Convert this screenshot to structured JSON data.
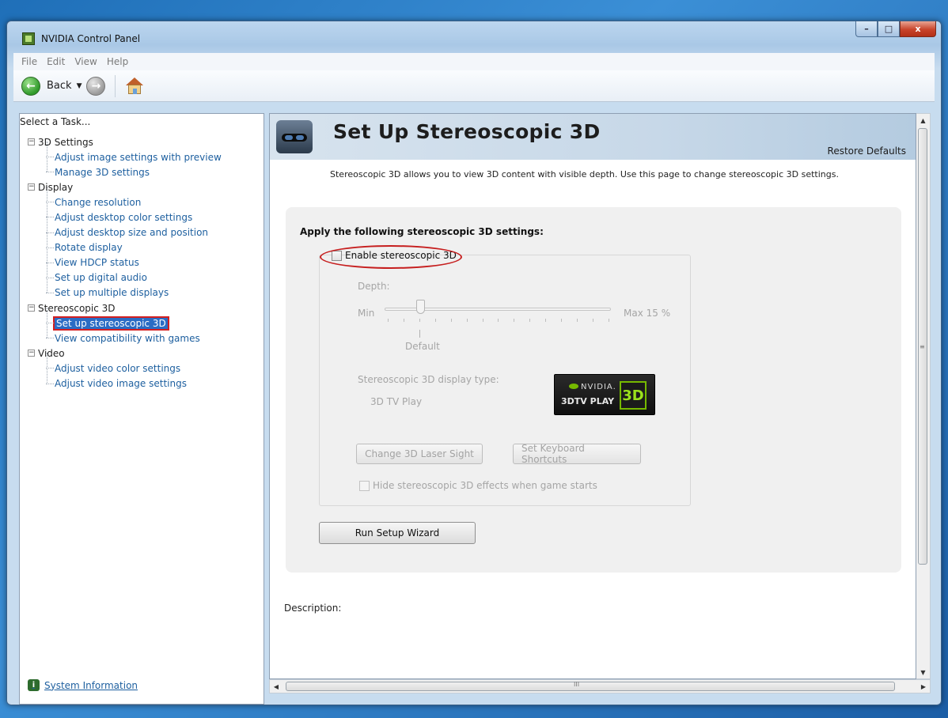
{
  "window": {
    "title": "NVIDIA Control Panel",
    "controls": {
      "minimize": "–",
      "maximize": "□",
      "close": "x"
    }
  },
  "menu": [
    "File",
    "Edit",
    "View",
    "Help"
  ],
  "toolbar": {
    "back_label": "Back"
  },
  "left_panel": {
    "header": "Select a Task...",
    "tree": [
      {
        "label": "3D Settings",
        "children": [
          "Adjust image settings with preview",
          "Manage 3D settings"
        ]
      },
      {
        "label": "Display",
        "children": [
          "Change resolution",
          "Adjust desktop color settings",
          "Adjust desktop size and position",
          "Rotate display",
          "View HDCP status",
          "Set up digital audio",
          "Set up multiple displays"
        ]
      },
      {
        "label": "Stereoscopic 3D",
        "children": [
          "Set up stereoscopic 3D",
          "View compatibility with games"
        ]
      },
      {
        "label": "Video",
        "children": [
          "Adjust video color settings",
          "Adjust video image settings"
        ]
      }
    ],
    "selected_item": "Set up stereoscopic 3D",
    "system_info": "System Information"
  },
  "page": {
    "title": "Set Up Stereoscopic 3D",
    "restore_defaults": "Restore Defaults",
    "intro": "Stereoscopic 3D allows you to view 3D content with visible depth. Use this page to change stereoscopic 3D settings.",
    "settings_heading": "Apply the following stereoscopic 3D settings:",
    "enable_label": "Enable stereoscopic 3D",
    "enable_checked": false,
    "depth_label": "Depth:",
    "depth_min": "Min",
    "depth_max": "Max  15  %",
    "depth_value_percent": 15,
    "depth_default": "Default",
    "display_type_label": "Stereoscopic 3D display type:",
    "display_type_value": "3D TV Play",
    "badge": {
      "brand": "NVIDIA.",
      "product": "3DTV PLAY",
      "mark": "3D"
    },
    "laser_sight_button": "Change 3D Laser Sight",
    "shortcuts_button": "Set Keyboard Shortcuts",
    "hide_effects_label": "Hide stereoscopic 3D effects when game starts",
    "hide_effects_checked": false,
    "wizard_button": "Run Setup Wizard",
    "description_label": "Description:"
  },
  "scrollbar": {
    "up": "▲",
    "down": "▼",
    "left": "◀",
    "right": "▶",
    "grip_v": "≡",
    "grip_h": "III"
  },
  "colors": {
    "selection": "#2a6cc4",
    "highlight_ring": "#c61e1e",
    "link": "#1d5f9f",
    "nvidia_green": "#76b900"
  }
}
